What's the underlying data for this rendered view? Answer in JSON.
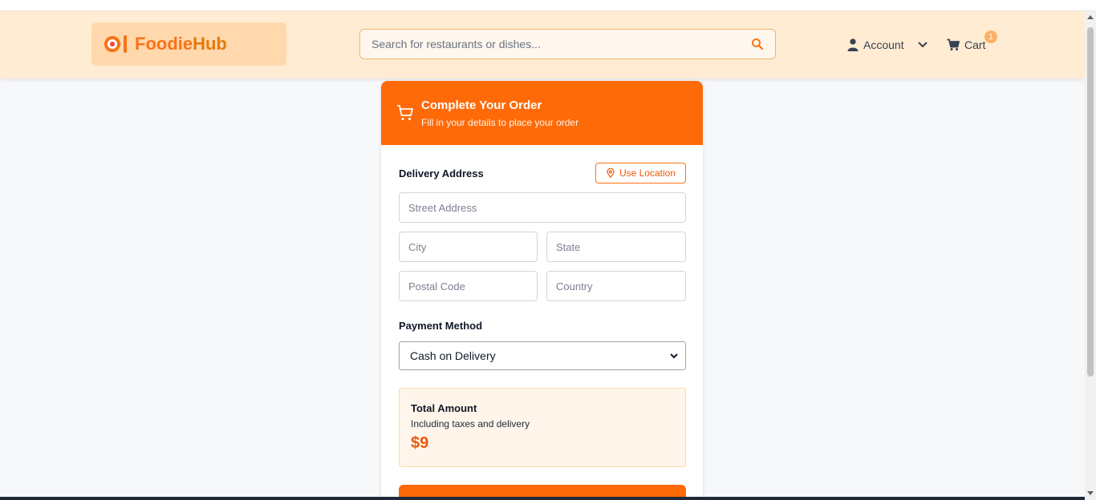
{
  "brand": {
    "name_part1": "Foodie",
    "name_part2": "Hub"
  },
  "search": {
    "placeholder": "Search for restaurants or dishes..."
  },
  "nav": {
    "account_label": "Account",
    "cart_label": "Cart",
    "cart_count": "1"
  },
  "checkout": {
    "title": "Complete Your Order",
    "subtitle": "Fill in your details to place your order",
    "delivery_label": "Delivery Address",
    "use_location_label": "Use Location",
    "fields": {
      "street": "Street Address",
      "city": "City",
      "state": "State",
      "postal": "Postal Code",
      "country": "Country"
    },
    "payment_label": "Payment Method",
    "payment_selected": "Cash on Delivery",
    "total_title": "Total Amount",
    "total_sub": "Including taxes and delivery",
    "total_amount": "$9"
  },
  "colors": {
    "accent": "#ff6a08",
    "header_bg": "#ffecd2",
    "logo_bg": "#ffd8ad",
    "total_bg": "#fff5ea"
  },
  "icons": [
    "logo-icon",
    "search-icon",
    "user-icon",
    "chevron-down-icon",
    "cart-icon",
    "pin-icon"
  ]
}
